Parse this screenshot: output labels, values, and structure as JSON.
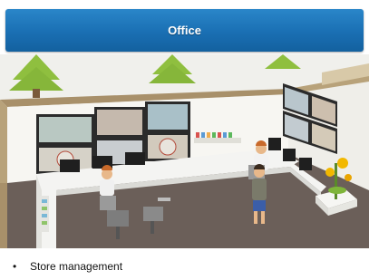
{
  "header": {
    "title": "Office"
  },
  "illustration": {
    "subject": "isometric store office with security monitors"
  },
  "caption": {
    "bullet": "•",
    "text": "Store management"
  },
  "colors": {
    "header_bar": "#1a6fb3",
    "header_text": "#ffffff",
    "floor": "#6b5f59",
    "wall": "#b8a27a",
    "desk": "#f4f4f2",
    "tree": "#8fbf3f"
  }
}
